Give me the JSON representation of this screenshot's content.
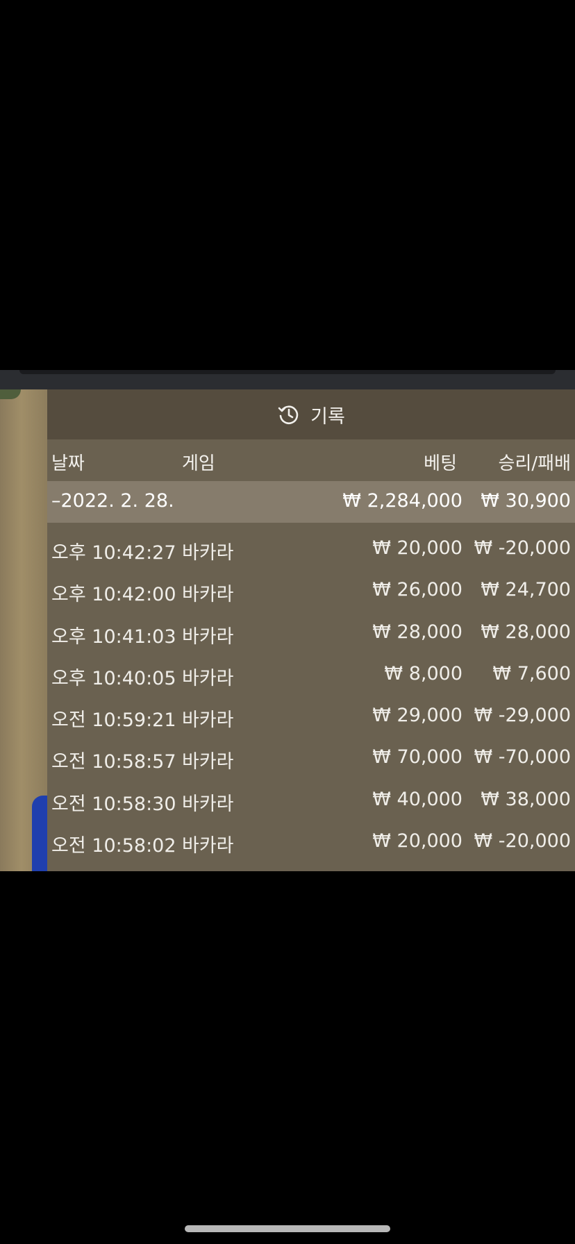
{
  "panel": {
    "title": "기록",
    "icon": "history-icon"
  },
  "columns": {
    "date": "날짜",
    "game": "게임",
    "bet": "베팅",
    "result": "승리/패배"
  },
  "summary": {
    "date": "–2022. 2. 28.",
    "bet": "₩ 2,284,000",
    "result": "₩ 30,900"
  },
  "rows": [
    {
      "time": "오후 10:42:27",
      "game": "바카라",
      "bet": "₩ 20,000",
      "result": "₩ -20,000"
    },
    {
      "time": "오후 10:42:00",
      "game": "바카라",
      "bet": "₩ 26,000",
      "result": "₩ 24,700"
    },
    {
      "time": "오후 10:41:03",
      "game": "바카라",
      "bet": "₩ 28,000",
      "result": "₩ 28,000"
    },
    {
      "time": "오후 10:40:05",
      "game": "바카라",
      "bet": "₩ 8,000",
      "result": "₩ 7,600"
    },
    {
      "time": "오전 10:59:21",
      "game": "바카라",
      "bet": "₩ 29,000",
      "result": "₩ -29,000"
    },
    {
      "time": "오전 10:58:57",
      "game": "바카라",
      "bet": "₩ 70,000",
      "result": "₩ -70,000"
    },
    {
      "time": "오전 10:58:30",
      "game": "바카라",
      "bet": "₩ 40,000",
      "result": "₩ 38,000"
    },
    {
      "time": "오전 10:58:02",
      "game": "바카라",
      "bet": "₩ 20,000",
      "result": "₩ -20,000"
    }
  ],
  "colors": {
    "panel_bg": "#6a6150",
    "header_bg": "#554c3e",
    "summary_bg": "#867c6c"
  }
}
